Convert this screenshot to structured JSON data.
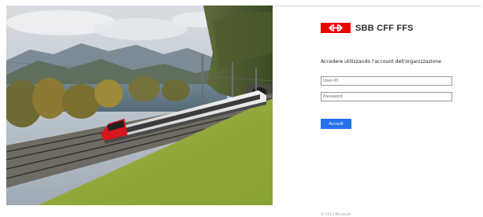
{
  "brand": {
    "logo_text": "SBB CFF FFS",
    "accent_color": "#eb0000"
  },
  "illustration": {
    "icon": "train-landscape-photo"
  },
  "sign_in": {
    "prompt": "Accedere utilizzando l'account dell'organizzazione",
    "userid_placeholder": "User-ID",
    "userid_value": "",
    "password_placeholder": "Password",
    "password_value": "",
    "submit_label": "Accedi",
    "submit_color": "#2672ec"
  },
  "footer": {
    "copyright": "© 2013 Microsoft"
  }
}
